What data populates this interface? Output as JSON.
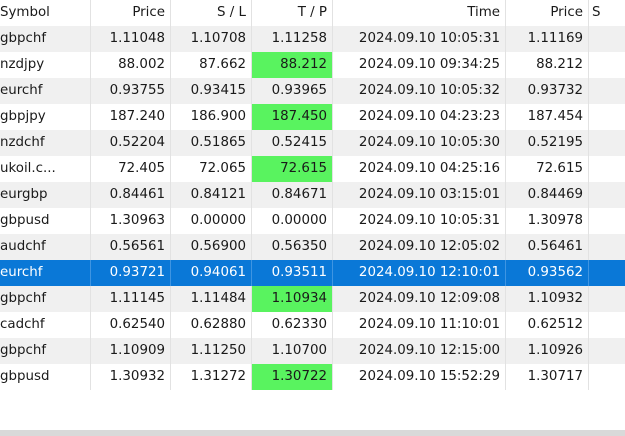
{
  "columns": [
    "Symbol",
    "Price",
    "S / L",
    "T / P",
    "Time",
    "Price",
    "S"
  ],
  "colors": {
    "selected_row": "#0a78d7",
    "tp_hit": "#59f35f",
    "alt_row": "#f0f0f0"
  },
  "rows": [
    {
      "symbol": "gbpchf",
      "price": "1.11048",
      "sl": "1.10708",
      "tp": "1.11258",
      "time": "2024.09.10 10:05:31",
      "close_price": "1.11169",
      "tp_hit": false,
      "selected": false
    },
    {
      "symbol": "nzdjpy",
      "price": "88.002",
      "sl": "87.662",
      "tp": "88.212",
      "time": "2024.09.10 09:34:25",
      "close_price": "88.212",
      "tp_hit": true,
      "selected": false
    },
    {
      "symbol": "eurchf",
      "price": "0.93755",
      "sl": "0.93415",
      "tp": "0.93965",
      "time": "2024.09.10 10:05:32",
      "close_price": "0.93732",
      "tp_hit": false,
      "selected": false
    },
    {
      "symbol": "gbpjpy",
      "price": "187.240",
      "sl": "186.900",
      "tp": "187.450",
      "time": "2024.09.10 04:23:23",
      "close_price": "187.454",
      "tp_hit": true,
      "selected": false
    },
    {
      "symbol": "nzdchf",
      "price": "0.52204",
      "sl": "0.51865",
      "tp": "0.52415",
      "time": "2024.09.10 10:05:30",
      "close_price": "0.52195",
      "tp_hit": false,
      "selected": false
    },
    {
      "symbol": "ukoil.c...",
      "price": "72.405",
      "sl": "72.065",
      "tp": "72.615",
      "time": "2024.09.10 04:25:16",
      "close_price": "72.615",
      "tp_hit": true,
      "selected": false
    },
    {
      "symbol": "eurgbp",
      "price": "0.84461",
      "sl": "0.84121",
      "tp": "0.84671",
      "time": "2024.09.10 03:15:01",
      "close_price": "0.84469",
      "tp_hit": false,
      "selected": false
    },
    {
      "symbol": "gbpusd",
      "price": "1.30963",
      "sl": "0.00000",
      "tp": "0.00000",
      "time": "2024.09.10 10:05:31",
      "close_price": "1.30978",
      "tp_hit": false,
      "selected": false
    },
    {
      "symbol": "audchf",
      "price": "0.56561",
      "sl": "0.56900",
      "tp": "0.56350",
      "time": "2024.09.10 12:05:02",
      "close_price": "0.56461",
      "tp_hit": false,
      "selected": false
    },
    {
      "symbol": "eurchf",
      "price": "0.93721",
      "sl": "0.94061",
      "tp": "0.93511",
      "time": "2024.09.10 12:10:01",
      "close_price": "0.93562",
      "tp_hit": false,
      "selected": true
    },
    {
      "symbol": "gbpchf",
      "price": "1.11145",
      "sl": "1.11484",
      "tp": "1.10934",
      "time": "2024.09.10 12:09:08",
      "close_price": "1.10932",
      "tp_hit": true,
      "selected": false
    },
    {
      "symbol": "cadchf",
      "price": "0.62540",
      "sl": "0.62880",
      "tp": "0.62330",
      "time": "2024.09.10 11:10:01",
      "close_price": "0.62512",
      "tp_hit": false,
      "selected": false
    },
    {
      "symbol": "gbpchf",
      "price": "1.10909",
      "sl": "1.11250",
      "tp": "1.10700",
      "time": "2024.09.10 12:15:00",
      "close_price": "1.10926",
      "tp_hit": false,
      "selected": false
    },
    {
      "symbol": "gbpusd",
      "price": "1.30932",
      "sl": "1.31272",
      "tp": "1.30722",
      "time": "2024.09.10 15:52:29",
      "close_price": "1.30717",
      "tp_hit": true,
      "selected": false
    }
  ]
}
